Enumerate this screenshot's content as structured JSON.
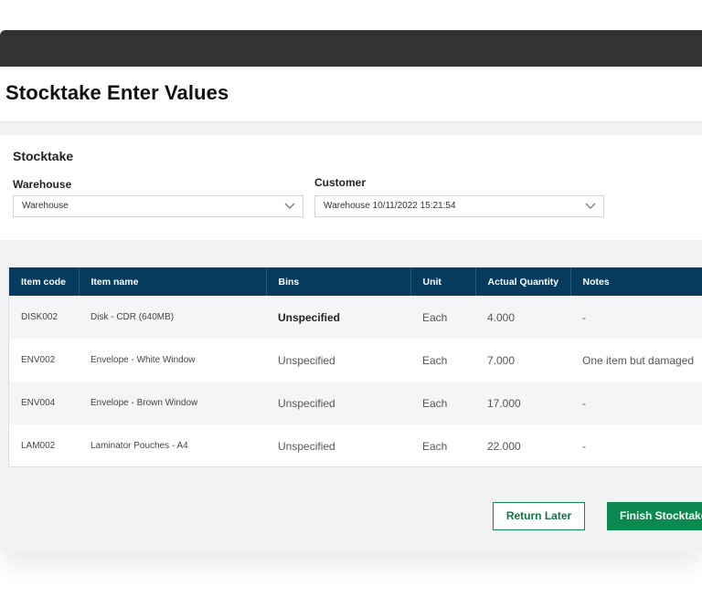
{
  "page": {
    "title": "Stocktake Enter Values"
  },
  "filters": {
    "section_title": "Stocktake",
    "warehouse": {
      "label": "Warehouse",
      "value": "Warehouse"
    },
    "customer": {
      "label": "Customer",
      "value": "Warehouse 10/11/2022 15:21:54"
    }
  },
  "table": {
    "columns": [
      "Item code",
      "Item name",
      "Bins",
      "Unit",
      "Actual Quantity",
      "Notes"
    ],
    "rows": [
      {
        "code": "DISK002",
        "name": "Disk - CDR (640MB)",
        "bins": "Unspecified",
        "unit": "Each",
        "qty": "4.000",
        "notes": "-"
      },
      {
        "code": "ENV002",
        "name": "Envelope - White Window",
        "bins": "Unspecified",
        "unit": "Each",
        "qty": "7.000",
        "notes": "One item but damaged"
      },
      {
        "code": "ENV004",
        "name": "Envelope - Brown Window",
        "bins": "Unspecified",
        "unit": "Each",
        "qty": "17.000",
        "notes": "-"
      },
      {
        "code": "LAM002",
        "name": "Laminator Pouches - A4",
        "bins": "Unspecified",
        "unit": "Each",
        "qty": "22.000",
        "notes": "-"
      }
    ]
  },
  "actions": {
    "return_later": "Return Later",
    "finish": "Finish Stocktake"
  },
  "colors": {
    "header": "#063b5e",
    "accent": "#0a8a4e",
    "topbar": "#333333"
  }
}
